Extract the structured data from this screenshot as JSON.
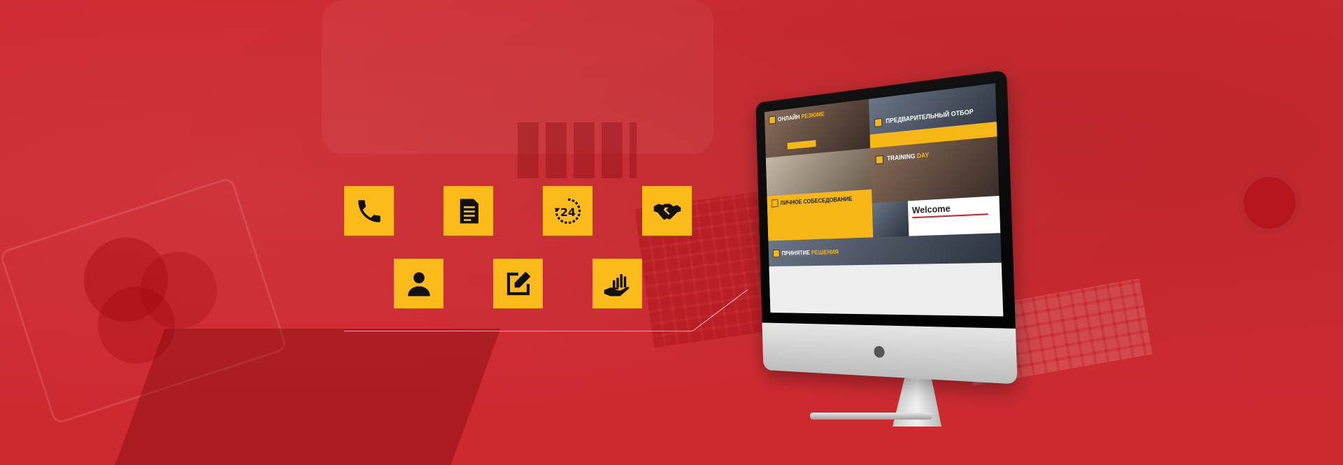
{
  "colors": {
    "background": "#cd2a30",
    "accent": "#fcbb1b",
    "icon_ink": "#111111"
  },
  "icons": [
    {
      "name": "phone-icon"
    },
    {
      "name": "document-icon"
    },
    {
      "name": "24-hours-icon",
      "text": "24"
    },
    {
      "name": "handshake-icon"
    },
    {
      "name": "user-icon"
    },
    {
      "name": "edit-icon"
    },
    {
      "name": "growth-hand-icon"
    }
  ],
  "monitor": {
    "screen": {
      "tile1_title": "ОНЛАЙН",
      "tile1_highlight": "РЕЗЮМЕ",
      "tile2_title": "ПРЕДВАРИТЕЛЬНЫЙ ОТБОР",
      "tile3_title": "TRAINING",
      "tile3_highlight": "DAY",
      "tile4_title": "ЛИЧНОЕ СОБЕСЕДОВАНИЕ",
      "tile5_title": "ПРИНЯТИЕ",
      "tile5_highlight": "РЕШЕНИЯ",
      "welcome": "Welcome"
    },
    "logo_icon": "apple-logo"
  }
}
